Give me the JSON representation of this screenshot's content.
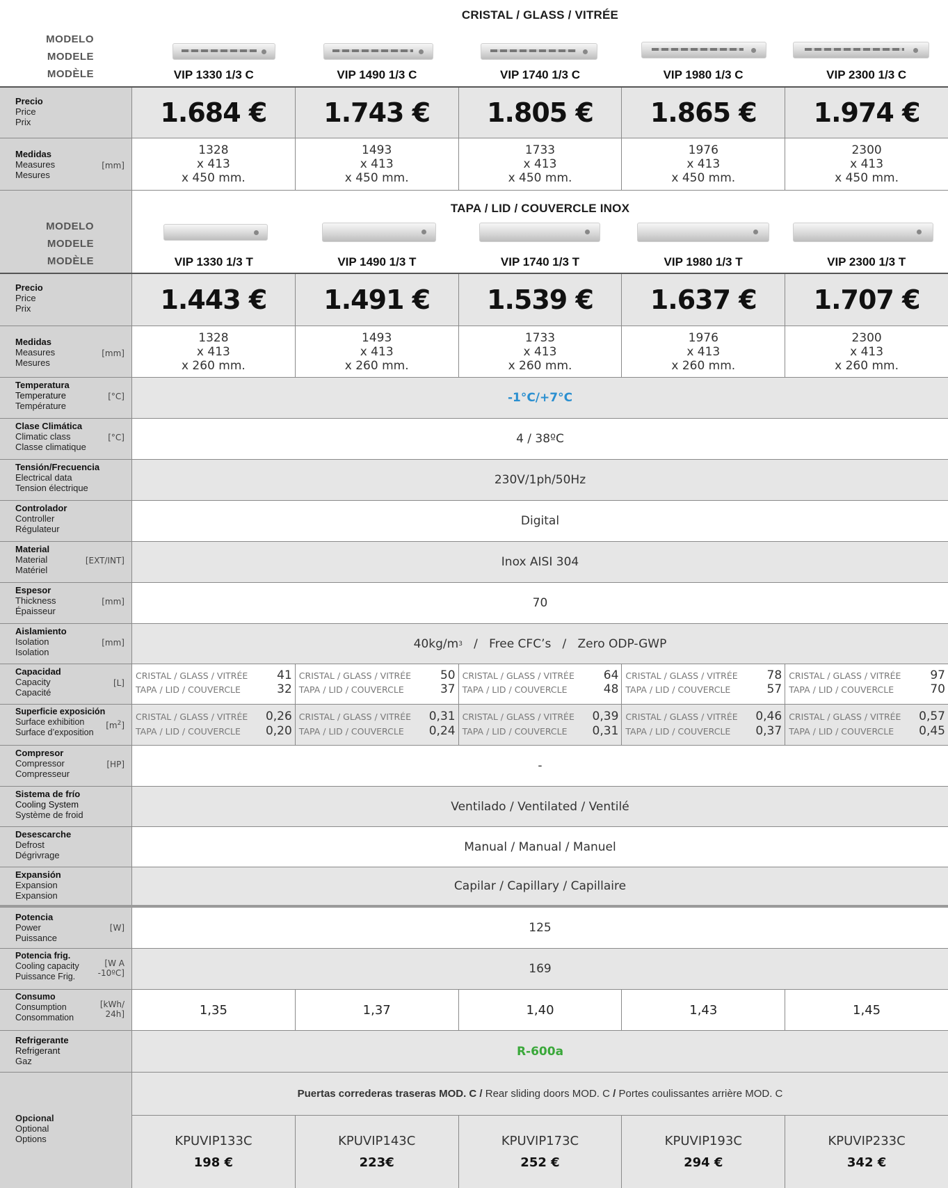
{
  "glass_section": {
    "title": "CRISTAL / GLASS / VITRÉE",
    "modelo": [
      "MODELO",
      "MODELE",
      "MODÈLE"
    ],
    "models": [
      "VIP 1330 1/3 C",
      "VIP 1490 1/3 C",
      "VIP 1740 1/3 C",
      "VIP 1980 1/3 C",
      "VIP 2300 1/3 C"
    ],
    "price_label": [
      "Precio",
      "Price",
      "Prix"
    ],
    "prices": [
      "1.684 €",
      "1.743 €",
      "1.805 €",
      "1.865 €",
      "1.974 €"
    ],
    "measures_label": [
      "Medidas",
      "Measures",
      "Mesures"
    ],
    "measures_unit": "[mm]",
    "measures": [
      [
        "1328",
        "x 413",
        "x 450 mm."
      ],
      [
        "1493",
        "x 413",
        "x 450 mm."
      ],
      [
        "1733",
        "x 413",
        "x 450 mm."
      ],
      [
        "1976",
        "x 413",
        "x 450 mm."
      ],
      [
        "2300",
        "x 413",
        "x 450 mm."
      ]
    ]
  },
  "lid_section": {
    "title": "TAPA / LID / COUVERCLE INOX",
    "modelo": [
      "MODELO",
      "MODELE",
      "MODÈLE"
    ],
    "models": [
      "VIP 1330 1/3 T",
      "VIP 1490 1/3 T",
      "VIP 1740 1/3 T",
      "VIP 1980 1/3 T",
      "VIP 2300 1/3 T"
    ],
    "price_label": [
      "Precio",
      "Price",
      "Prix"
    ],
    "prices": [
      "1.443 €",
      "1.491 €",
      "1.539 €",
      "1.637 €",
      "1.707 €"
    ],
    "measures_label": [
      "Medidas",
      "Measures",
      "Mesures"
    ],
    "measures_unit": "[mm]",
    "measures": [
      [
        "1328",
        "x 413",
        "x 260 mm."
      ],
      [
        "1493",
        "x 413",
        "x 260 mm."
      ],
      [
        "1733",
        "x 413",
        "x 260 mm."
      ],
      [
        "1976",
        "x 413",
        "x 260 mm."
      ],
      [
        "2300",
        "x 413",
        "x 260 mm."
      ]
    ]
  },
  "specs": {
    "temperature": {
      "label": [
        "Temperatura",
        "Temperature",
        "Température"
      ],
      "unit": "[°C]",
      "value": "-1°C/+7°C",
      "color": "#2a8fd0"
    },
    "climatic": {
      "label": [
        "Clase Climática",
        "Climatic class",
        "Classe climatique"
      ],
      "unit": "[°C]",
      "value": "4 / 38ºC"
    },
    "electrical": {
      "label": [
        "Tensión/Frecuencia",
        "Electrical data",
        "Tension électrique"
      ],
      "value": "230V/1ph/50Hz"
    },
    "controller": {
      "label": [
        "Controlador",
        "Controller",
        "Régulateur"
      ],
      "value": "Digital"
    },
    "material": {
      "label": [
        "Material",
        "Material",
        "Matériel"
      ],
      "unit": "[EXT/INT]",
      "value": "Inox AISI 304"
    },
    "thickness": {
      "label": [
        "Espesor",
        "Thickness",
        "Épaisseur"
      ],
      "unit": "[mm]",
      "value": "70"
    },
    "isolation": {
      "label": [
        "Aislamiento",
        "Isolation",
        "Isolation"
      ],
      "unit": "[mm]",
      "value_a": "40kg/m",
      "value_sup": "3",
      "value_b": "/   Free CFC’s   /   Zero ODP-GWP"
    },
    "capacity": {
      "label": [
        "Capacidad",
        "Capacity",
        "Capacité"
      ],
      "unit": "[L]",
      "glass_label": "CRISTAL / GLASS / VITRÉE",
      "lid_label": "TAPA / LID / COUVERCLE",
      "glass": [
        "41",
        "50",
        "64",
        "78",
        "97"
      ],
      "lid": [
        "32",
        "37",
        "48",
        "57",
        "70"
      ]
    },
    "surface": {
      "label": [
        "Superficie exposición",
        "Surface exhibition",
        "Surface d’exposition"
      ],
      "unit": "[m",
      "unit_sup": "2",
      "unit_end": "]",
      "glass_label": "CRISTAL / GLASS / VITRÉE",
      "lid_label": "TAPA / LID / COUVERCLE",
      "glass": [
        "0,26",
        "0,31",
        "0,39",
        "0,46",
        "0,57"
      ],
      "lid": [
        "0,20",
        "0,24",
        "0,31",
        "0,37",
        "0,45"
      ]
    },
    "compressor": {
      "label": [
        "Compresor",
        "Compressor",
        "Compresseur"
      ],
      "unit": "[HP]",
      "value": "-"
    },
    "cooling": {
      "label": [
        "Sistema de frío",
        "Cooling System",
        "Système de froid"
      ],
      "value": "Ventilado / Ventilated / Ventilé"
    },
    "defrost": {
      "label": [
        "Desescarche",
        "Defrost",
        "Dégrivrage"
      ],
      "value": "Manual / Manual / Manuel"
    },
    "expansion": {
      "label": [
        "Expansión",
        "Expansion",
        "Expansion"
      ],
      "value": "Capilar / Capillary / Capillaire"
    },
    "power": {
      "label": [
        "Potencia",
        "Power",
        "Puissance"
      ],
      "unit": "[W]",
      "value": "125"
    },
    "cooling_capacity": {
      "label": [
        "Potencia frig.",
        "Cooling capacity",
        "Puissance Frig."
      ],
      "unit": "[W A\n-10ºC]",
      "value": "169"
    },
    "consumption": {
      "label": [
        "Consumo",
        "Consumption",
        "Consommation"
      ],
      "unit": "[kWh/\n24h]",
      "values": [
        "1,35",
        "1,37",
        "1,40",
        "1,43",
        "1,45"
      ]
    },
    "refrigerant": {
      "label": [
        "Refrigerante",
        "Refrigerant",
        "Gaz"
      ],
      "value": "R-600a",
      "color": "#3aa83a"
    }
  },
  "options": {
    "label": [
      "Opcional",
      "Optional",
      "Options"
    ],
    "header_bold_1": "Puertas correderas traseras MOD. C /",
    "header_normal_1": " Rear sliding doors MOD. C ",
    "header_bold_2": "/",
    "header_normal_2": " Portes coulissantes arrière MOD. C",
    "codes": [
      "KPUVIP133C",
      "KPUVIP143C",
      "KPUVIP173C",
      "KPUVIP193C",
      "KPUVIP233C"
    ],
    "prices": [
      "198 €",
      "223€",
      "252 €",
      "294 €",
      "342 €"
    ]
  }
}
